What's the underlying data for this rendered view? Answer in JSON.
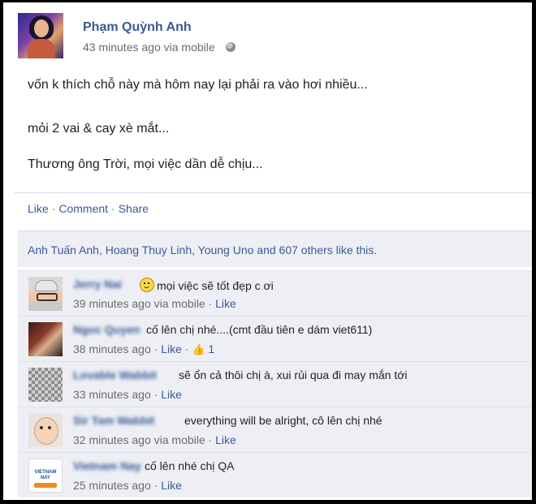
{
  "post": {
    "author": "Phạm Quỳnh Anh",
    "time": "43 minutes ago via mobile",
    "lines": [
      "vốn k thích chỗ này mà hôm nay lại phải ra vào hơi nhiều...",
      "mỏi 2 vai & cay xè mắt...",
      "Thương ông Trời, mọi việc dần dễ chịu..."
    ],
    "actions": {
      "like": "Like",
      "comment": "Comment",
      "share": "Share"
    },
    "likes": "Anh Tuấn Anh, Hoang Thuy Linh, Young Uno and 607 others like this."
  },
  "comments": [
    {
      "name": "Jerry Nai",
      "text": "mọi việc sẽ tốt đẹp c ơi",
      "meta": "39 minutes ago via mobile",
      "like": "Like"
    },
    {
      "name": "Ngoc Quyen",
      "text": "cố lên chị nhé....(cmt đầu tiên e dám viet611)",
      "meta": "38 minutes ago",
      "like": "Like",
      "like_count": "1"
    },
    {
      "name": "Lovable Wabbit",
      "text": "sẽ ổn cả thôi chị à, xui rủi qua đi may mắn tới",
      "meta": "33 minutes ago",
      "like": "Like"
    },
    {
      "name": "Sir Tam Wabbit",
      "text": "everything will be alright, cô lên chị nhé",
      "meta": "32 minutes ago via mobile",
      "like": "Like"
    },
    {
      "name": "Vietnam Nay",
      "text": "cố lên nhé chị QA",
      "meta": "25 minutes ago",
      "like": "Like",
      "avatar_label": "VIETNAM NAY"
    }
  ]
}
